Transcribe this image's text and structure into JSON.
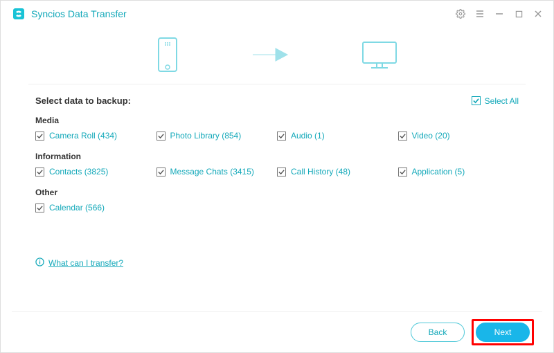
{
  "app": {
    "title": "Syncios Data Transfer"
  },
  "header": {
    "title": "Select data to backup:",
    "selectAll": "Select All"
  },
  "groups": {
    "media": {
      "title": "Media",
      "items": [
        {
          "label": "Camera Roll (434)"
        },
        {
          "label": "Photo Library (854)"
        },
        {
          "label": "Audio (1)"
        },
        {
          "label": "Video (20)"
        }
      ]
    },
    "information": {
      "title": "Information",
      "items": [
        {
          "label": "Contacts (3825)"
        },
        {
          "label": "Message Chats (3415)"
        },
        {
          "label": "Call History (48)"
        },
        {
          "label": "Application (5)"
        }
      ]
    },
    "other": {
      "title": "Other",
      "items": [
        {
          "label": "Calendar (566)"
        }
      ]
    }
  },
  "help": {
    "text": "What can I transfer?"
  },
  "footer": {
    "back": "Back",
    "next": "Next"
  }
}
